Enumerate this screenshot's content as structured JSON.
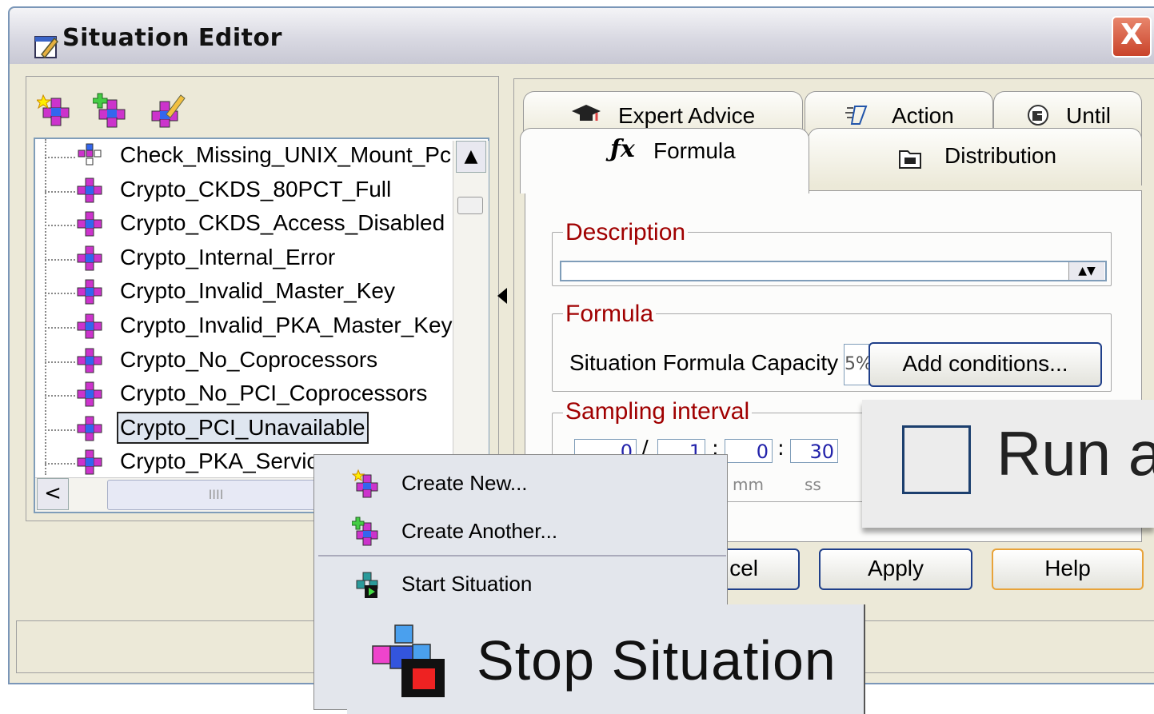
{
  "window": {
    "title": "Situation Editor",
    "close_label": "X",
    "title_icon": "edit-window-icon"
  },
  "toolbar": {
    "icons": [
      "create-new-situation-icon",
      "create-another-situation-icon",
      "edit-situation-icon"
    ]
  },
  "tree": {
    "items": [
      {
        "label": "Check_Missing_UNIX_Mount_Pc",
        "icon": "situation-group-icon"
      },
      {
        "label": "Crypto_CKDS_80PCT_Full",
        "icon": "situation-icon"
      },
      {
        "label": "Crypto_CKDS_Access_Disabled",
        "icon": "situation-icon"
      },
      {
        "label": "Crypto_Internal_Error",
        "icon": "situation-icon"
      },
      {
        "label": "Crypto_Invalid_Master_Key",
        "icon": "situation-icon"
      },
      {
        "label": "Crypto_Invalid_PKA_Master_Key",
        "icon": "situation-icon"
      },
      {
        "label": "Crypto_No_Coprocessors",
        "icon": "situation-icon"
      },
      {
        "label": "Crypto_No_PCI_Coprocessors",
        "icon": "situation-icon"
      },
      {
        "label": "Crypto_PCI_Unavailable",
        "icon": "situation-icon",
        "selected": true
      },
      {
        "label": "Crypto_PKA_Servic",
        "icon": "situation-icon"
      }
    ],
    "hscroll_grip": "IIII"
  },
  "tabs": {
    "back_row": [
      {
        "label": "Expert Advice",
        "icon": "graduation-cap-icon"
      },
      {
        "label": "Action",
        "icon": "action-icon"
      },
      {
        "label": "Until",
        "icon": "until-icon"
      }
    ],
    "front_row": [
      {
        "label": "Formula",
        "icon": "fx-icon",
        "active": true
      },
      {
        "label": "Distribution",
        "icon": "distribution-icon"
      }
    ]
  },
  "description": {
    "title": "Description"
  },
  "formula": {
    "title": "Formula",
    "capacity_label": "Situation Formula Capacity",
    "capacity_value": "5%",
    "add_conditions_label": "Add conditions..."
  },
  "sampling": {
    "title": "Sampling interval",
    "values": [
      "0",
      "1",
      "0",
      "30"
    ],
    "units": [
      "mm",
      "ss"
    ]
  },
  "run_at": {
    "label": "Run a"
  },
  "buttons": {
    "cancel_label": "cel",
    "apply_label": "Apply",
    "help_label": "Help"
  },
  "context_menu": {
    "items": [
      {
        "label": "Create New...",
        "icon": "create-new-icon"
      },
      {
        "label": "Create Another...",
        "icon": "create-another-icon"
      },
      {
        "label": "Start Situation",
        "icon": "start-situation-icon"
      }
    ]
  },
  "stop_zoom": {
    "label": "Stop Situation",
    "icon": "stop-situation-icon"
  },
  "colors": {
    "group_title": "#a00000",
    "button_border": "#1f3f8a",
    "help_border": "#e8a33a",
    "selection_bg": "#dfe6f0"
  }
}
